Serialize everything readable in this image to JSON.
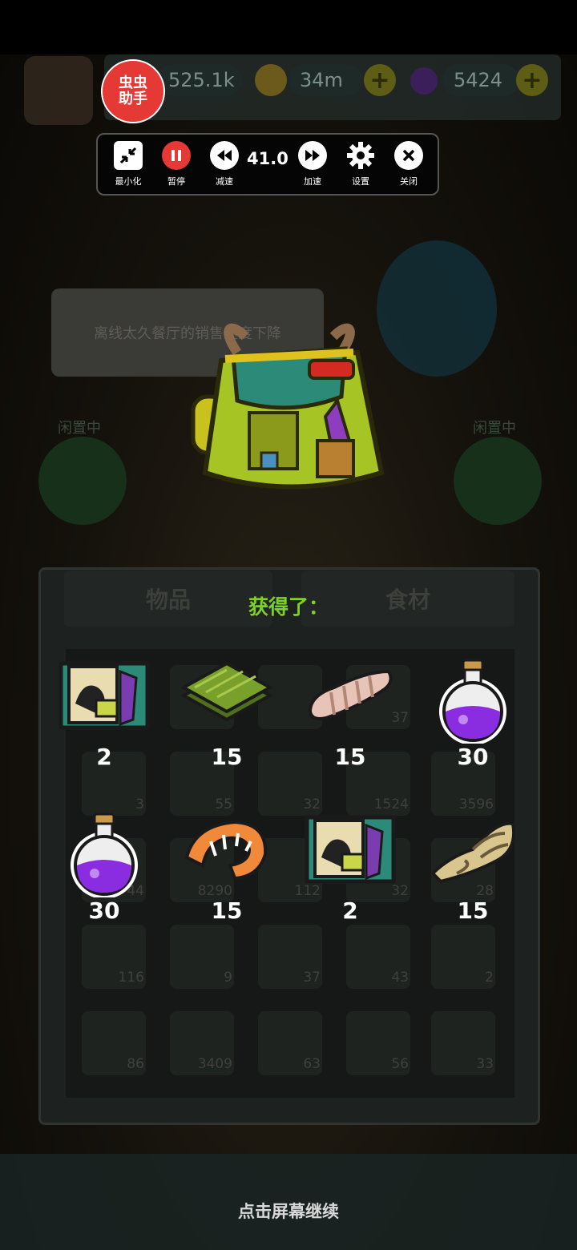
{
  "hud": {
    "currency1": "525.1k",
    "coins": "34m",
    "potions": "5424"
  },
  "helper": {
    "badge_line1": "虫虫",
    "badge_line2": "助手",
    "speed_value": "41.0",
    "buttons": [
      {
        "label": "最小化",
        "icon": "minimize-icon"
      },
      {
        "label": "暂停",
        "icon": "pause-icon"
      },
      {
        "label": "减速",
        "icon": "rewind-icon"
      },
      {
        "label": "加速",
        "icon": "fast-forward-icon"
      },
      {
        "label": "设置",
        "icon": "gear-icon"
      },
      {
        "label": "关闭",
        "icon": "close-icon"
      }
    ]
  },
  "background": {
    "speech": "离线太久餐厅的销售速度下降",
    "idle_left": "闲置中",
    "idle_right": "闲置中",
    "tab_items": "物品",
    "tab_ingredients": "食材",
    "grid_counts": [
      "2",
      "37",
      "3",
      "55",
      "32",
      "1524",
      "3596",
      "44",
      "8290",
      "112",
      "32",
      "28",
      "116",
      "9",
      "37",
      "43",
      "2",
      "86",
      "3409",
      "63",
      "56",
      "33"
    ]
  },
  "reward": {
    "title": "获得了：",
    "items": [
      {
        "name": "recipe-scroll",
        "qty": "2"
      },
      {
        "name": "seaweed",
        "qty": "15"
      },
      {
        "name": "sea-cucumber",
        "qty": "15"
      },
      {
        "name": "purple-potion",
        "qty": "30"
      },
      {
        "name": "purple-potion",
        "qty": "30"
      },
      {
        "name": "shrimp",
        "qty": "15"
      },
      {
        "name": "recipe-scroll",
        "qty": "2"
      },
      {
        "name": "conch-shell",
        "qty": "15"
      }
    ]
  },
  "footer": {
    "continue_text": "点击屏幕继续"
  },
  "colors": {
    "accent_green": "#7dd226",
    "helper_red": "#e53935",
    "pause_red": "#e53935"
  }
}
